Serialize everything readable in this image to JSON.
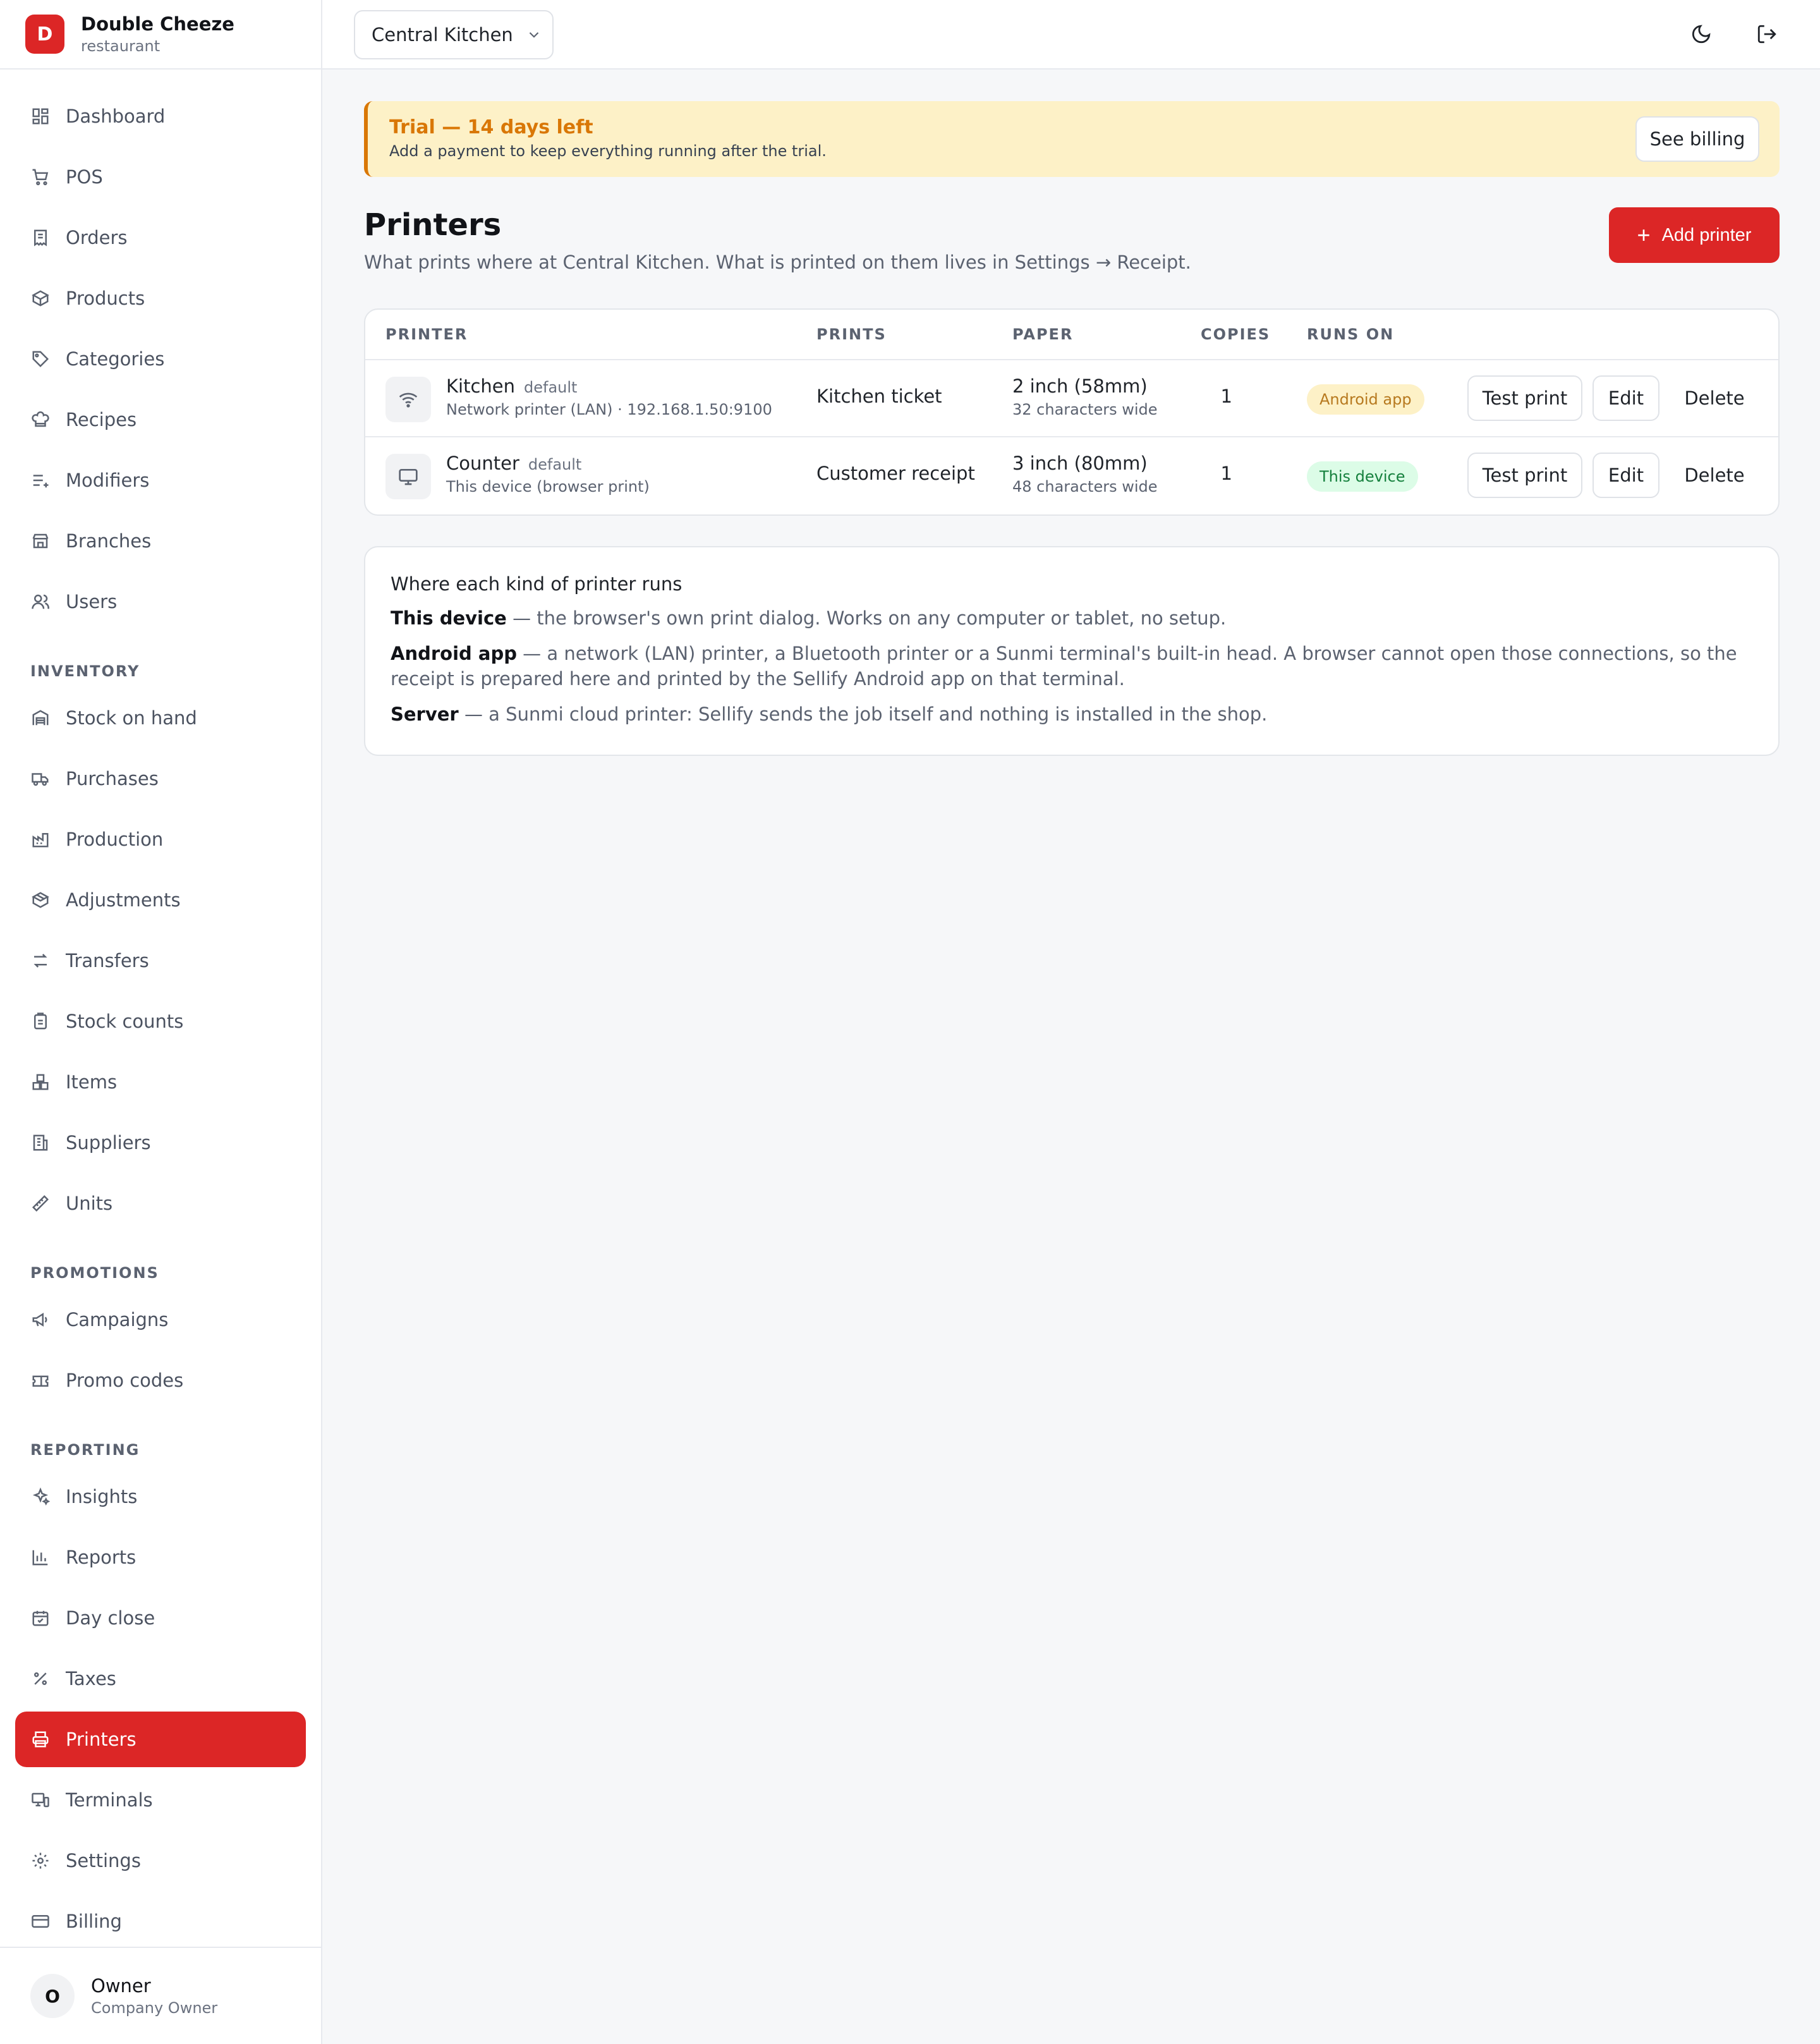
{
  "brand": {
    "logo_letter": "D",
    "name": "Double Cheeze",
    "type": "restaurant"
  },
  "nav": {
    "main": [
      {
        "label": "Dashboard",
        "icon": "dashboard-icon"
      },
      {
        "label": "POS",
        "icon": "cart-icon"
      },
      {
        "label": "Orders",
        "icon": "receipt-icon"
      },
      {
        "label": "Products",
        "icon": "box-icon"
      },
      {
        "label": "Categories",
        "icon": "tag-icon"
      },
      {
        "label": "Recipes",
        "icon": "chef-hat-icon"
      },
      {
        "label": "Modifiers",
        "icon": "list-plus-icon"
      },
      {
        "label": "Branches",
        "icon": "store-icon"
      },
      {
        "label": "Users",
        "icon": "users-icon"
      }
    ],
    "inventory_label": "INVENTORY",
    "inventory": [
      {
        "label": "Stock on hand",
        "icon": "warehouse-icon"
      },
      {
        "label": "Purchases",
        "icon": "truck-icon"
      },
      {
        "label": "Production",
        "icon": "factory-icon"
      },
      {
        "label": "Adjustments",
        "icon": "package-icon"
      },
      {
        "label": "Transfers",
        "icon": "arrows-swap-icon"
      },
      {
        "label": "Stock counts",
        "icon": "clipboard-icon"
      },
      {
        "label": "Items",
        "icon": "boxes-icon"
      },
      {
        "label": "Suppliers",
        "icon": "building-icon"
      },
      {
        "label": "Units",
        "icon": "ruler-icon"
      }
    ],
    "promotions_label": "PROMOTIONS",
    "promotions": [
      {
        "label": "Campaigns",
        "icon": "megaphone-icon"
      },
      {
        "label": "Promo codes",
        "icon": "ticket-icon"
      }
    ],
    "reporting_label": "REPORTING",
    "reporting": [
      {
        "label": "Insights",
        "icon": "sparkles-icon"
      },
      {
        "label": "Reports",
        "icon": "bar-chart-icon"
      },
      {
        "label": "Day close",
        "icon": "calendar-check-icon"
      },
      {
        "label": "Taxes",
        "icon": "percent-icon"
      },
      {
        "label": "Printers",
        "icon": "printer-icon",
        "active": true
      },
      {
        "label": "Terminals",
        "icon": "monitor-phone-icon"
      },
      {
        "label": "Settings",
        "icon": "gear-icon"
      },
      {
        "label": "Billing",
        "icon": "credit-card-icon"
      }
    ]
  },
  "user": {
    "initial": "O",
    "name": "Owner",
    "role": "Company Owner"
  },
  "topbar": {
    "branch": "Central Kitchen"
  },
  "trial": {
    "title": "Trial — 14 days left",
    "subtitle": "Add a payment to keep everything running after the trial.",
    "button": "See billing"
  },
  "page": {
    "title": "Printers",
    "subtitle": "What prints where at Central Kitchen. What is printed on them lives in Settings → Receipt.",
    "add_button": "Add printer"
  },
  "table": {
    "headers": [
      "PRINTER",
      "PRINTS",
      "PAPER",
      "COPIES",
      "RUNS ON"
    ],
    "rows": [
      {
        "icon": "wifi-icon",
        "name": "Kitchen",
        "default_label": "default",
        "meta": "Network printer (LAN) · 192.168.1.50:9100",
        "prints": "Kitchen ticket",
        "paper": "2 inch (58mm)",
        "chars": "32 characters wide",
        "copies": "1",
        "runs_on": "Android app",
        "runs_on_color": "#fdf1c7",
        "test": "Test print",
        "edit": "Edit",
        "delete": "Delete"
      },
      {
        "icon": "monitor-icon",
        "name": "Counter",
        "default_label": "default",
        "meta": "This device (browser print)",
        "prints": "Customer receipt",
        "paper": "3 inch (80mm)",
        "chars": "48 characters wide",
        "copies": "1",
        "runs_on": "This device",
        "runs_on_color": "#dcfce7",
        "test": "Test print",
        "edit": "Edit",
        "delete": "Delete"
      }
    ]
  },
  "info": {
    "title": "Where each kind of printer runs",
    "lines": [
      {
        "term": "This device",
        "text": " — the browser's own print dialog. Works on any computer or tablet, no setup."
      },
      {
        "term": "Android app",
        "text": " — a network (LAN) printer, a Bluetooth printer or a Sunmi terminal's built-in head. A browser cannot open those connections, so the receipt is prepared here and printed by the Sellify Android app on that terminal."
      },
      {
        "term": "Server",
        "text": " — a Sunmi cloud printer: Sellify sends the job itself and nothing is installed in the shop."
      }
    ]
  },
  "colors": {
    "accent": "#dc2626",
    "trial_bg": "#fdf1c7",
    "trial_text": "#d97706"
  }
}
